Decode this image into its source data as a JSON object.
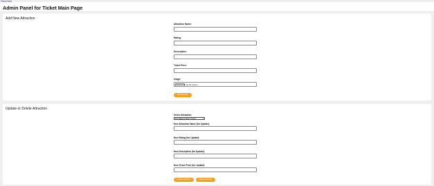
{
  "top_link": "Click Here",
  "page": {
    "title": "Admin Panel for Ticket Main Page"
  },
  "add_section": {
    "title": "Add New Attraction",
    "labels": {
      "name": "Attraction Name:",
      "rating": "Rating:",
      "description": "Description:",
      "price": "Ticket Price:",
      "image": "Image:"
    },
    "values": {
      "name": "",
      "rating": "",
      "description": "",
      "price": ""
    },
    "file_button": "Choose File",
    "file_status": "No file chosen",
    "submit": "Add Attraction"
  },
  "update_section": {
    "title": "Update or Delete Attraction",
    "labels": {
      "select": "Select Attraction:",
      "name": "New Attraction Name (for Update):",
      "rating": "New Rating (for Update):",
      "description": "New Description (for Update):",
      "price": "New Ticket Price (for Update):"
    },
    "select_value": "Pure Balance Bidan Theater",
    "values": {
      "name": "",
      "rating": "",
      "description": "",
      "price": ""
    },
    "update_button": "Update Attraction",
    "delete_button": "Delete Attraction"
  },
  "colors": {
    "accent": "#f5a01c",
    "page_bg": "#efefef",
    "panel_bg": "#ffffff"
  }
}
